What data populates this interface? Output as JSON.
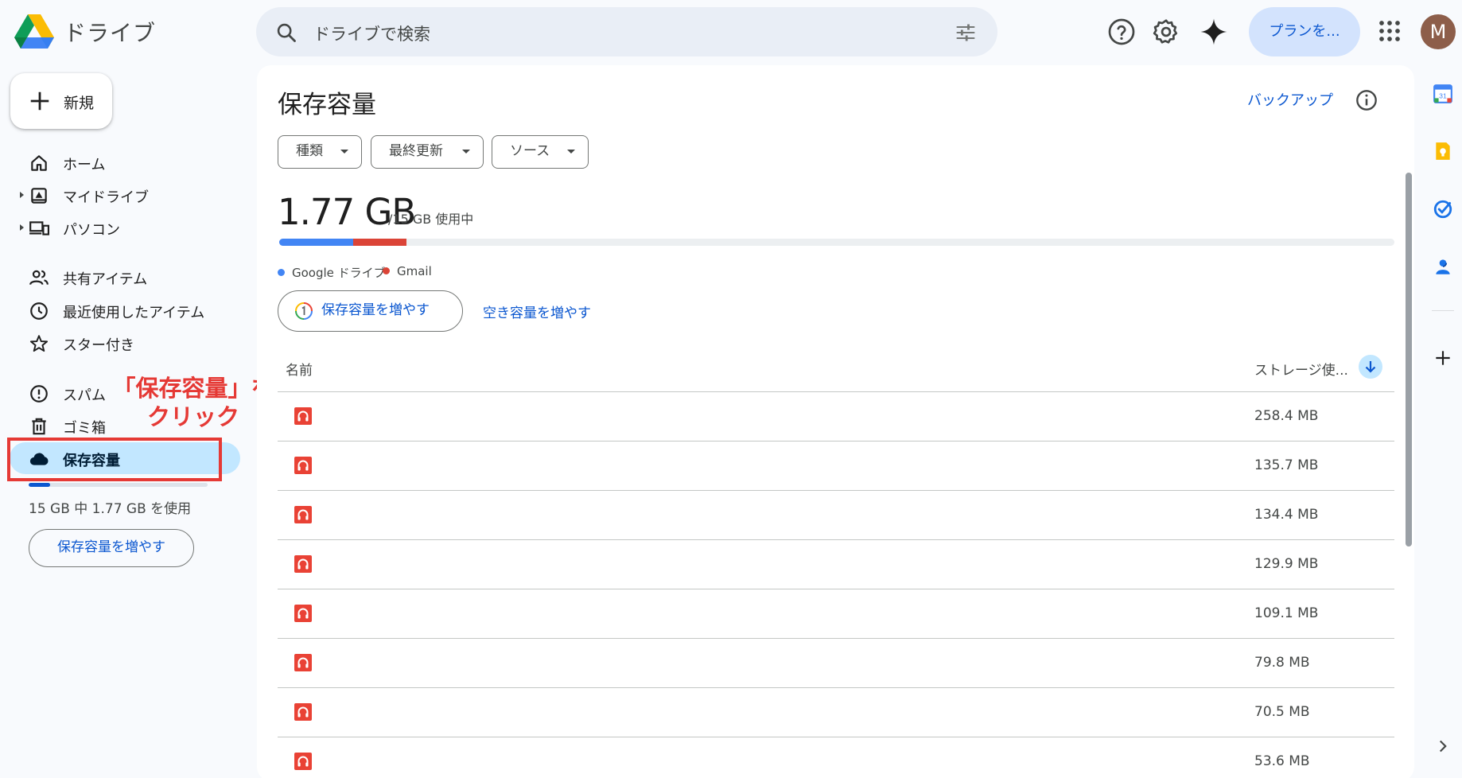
{
  "header": {
    "app_title": "ドライブ",
    "search_placeholder": "ドライブで検索",
    "plan_label": "プランを...",
    "avatar_letter": "M"
  },
  "sidebar": {
    "new_label": "新規",
    "items": [
      {
        "label": "ホーム",
        "icon": "home-icon"
      },
      {
        "label": "マイドライブ",
        "icon": "my-drive-icon"
      },
      {
        "label": "パソコン",
        "icon": "computer-icon"
      },
      {
        "label": "共有アイテム",
        "icon": "shared-icon"
      },
      {
        "label": "最近使用したアイテム",
        "icon": "clock-icon"
      },
      {
        "label": "スター付き",
        "icon": "star-icon"
      },
      {
        "label": "スパム",
        "icon": "spam-icon"
      },
      {
        "label": "ゴミ箱",
        "icon": "trash-icon"
      },
      {
        "label": "保存容量",
        "icon": "cloud-icon"
      }
    ],
    "storage_used_fraction": 0.118,
    "storage_note": "15 GB 中 1.77 GB を使用",
    "get_storage_label": "保存容量を増やす"
  },
  "annotation": {
    "line1": "「保存容量」を",
    "line2": "クリック",
    "color": "#e53935"
  },
  "main": {
    "title": "保存容量",
    "backup_label": "バックアップ",
    "filters": [
      "種類",
      "最終更新",
      "ソース"
    ],
    "usage_value": "1.77 GB",
    "usage_total": "/15 GB 使用中",
    "usage_segments": [
      {
        "name": "Google ドライブ",
        "fraction": 0.066,
        "color": "#4285f4"
      },
      {
        "name": "Gmail",
        "fraction": 0.048,
        "color": "#db4437"
      }
    ],
    "get_storage_label": "保存容量を増やす",
    "free_space_label": "空き容量を増やす",
    "col_name": "名前",
    "col_size": "ストレージ使...",
    "rows": [
      {
        "name": "",
        "size": "258.4 MB"
      },
      {
        "name": "",
        "size": "135.7 MB"
      },
      {
        "name": "",
        "size": "134.4 MB"
      },
      {
        "name": "",
        "size": "129.9 MB"
      },
      {
        "name": "",
        "size": "109.1 MB"
      },
      {
        "name": "",
        "size": "79.8 MB"
      },
      {
        "name": "",
        "size": "70.5 MB"
      },
      {
        "name": "",
        "size": "53.6 MB"
      }
    ]
  },
  "right_rail": [
    "calendar-icon",
    "keep-icon",
    "tasks-icon",
    "contacts-icon",
    "add-icon",
    "expand-icon"
  ]
}
